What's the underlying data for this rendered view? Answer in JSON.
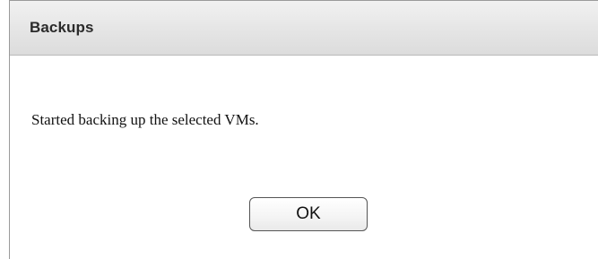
{
  "dialog": {
    "title": "Backups",
    "message": "Started backing up the selected VMs.",
    "ok_label": "OK"
  }
}
